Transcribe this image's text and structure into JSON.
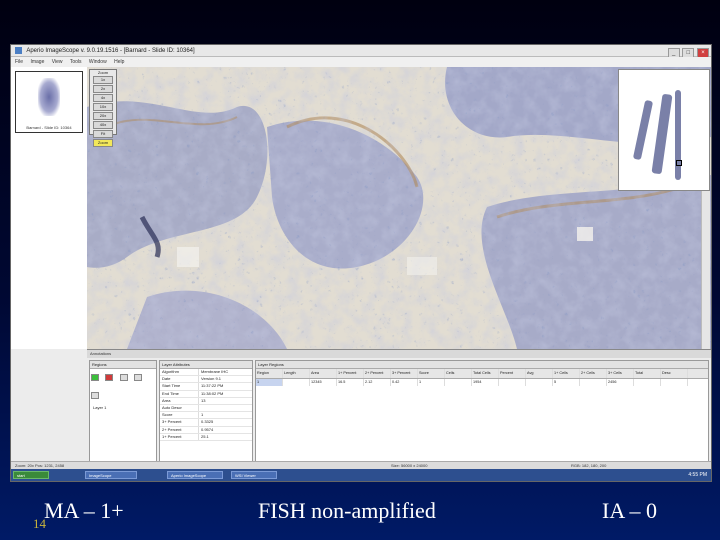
{
  "app": {
    "title": "Aperio ImageScope v. 9.0.19.1516 - [Barnard - Slide ID: 10364]",
    "menu": [
      "File",
      "Image",
      "View",
      "Tools",
      "Window",
      "Help"
    ],
    "window_buttons": [
      "_",
      "□",
      "×"
    ]
  },
  "thumbnail": {
    "caption": "Barnard - Slide ID: 10364"
  },
  "zoom_panel": {
    "title": "Zoom",
    "levels": [
      "1x",
      "2x",
      "4x",
      "10x",
      "20x",
      "40x",
      "Fit",
      "Zoom"
    ],
    "active_index": 7
  },
  "annotations": {
    "panel_title": "Annotations",
    "regions_title": "Regions",
    "region_item": "Layer 1",
    "tools": [
      "green",
      "red",
      "plain",
      "plain",
      "plain"
    ],
    "attributes_title": "Layer Attributes",
    "attributes": [
      {
        "k": "Algorithm",
        "v": "Membrane IHC"
      },
      {
        "k": "Date",
        "v": "Version 9.1"
      },
      {
        "k": "Start Time",
        "v": "11:37:22 PM"
      },
      {
        "k": "End Time",
        "v": "11:38:02 PM"
      },
      {
        "k": "Area",
        "v": "13"
      },
      {
        "k": "Auto Descr",
        "v": ""
      },
      {
        "k": "Score",
        "v": "1"
      },
      {
        "k": "3+ Percent",
        "v": "0.3325"
      },
      {
        "k": "2+ Percent",
        "v": "0.9574"
      },
      {
        "k": "1+ Percent",
        "v": "25.1"
      }
    ],
    "layer_regions_title": "Layer Regions",
    "grid_headers": [
      "Region",
      "Length",
      "Area",
      "1+ Percent",
      "2+ Percent",
      "3+ Percent",
      "Score",
      "Cells",
      "Total Cells",
      "Percent",
      "Avg",
      "1+ Cells",
      "2+ Cells",
      "3+ Cells",
      "Total",
      "Desc"
    ],
    "grid_row": [
      "1",
      "",
      "12345",
      "16.5",
      "2.12",
      "0.42",
      "1",
      "",
      "1954",
      "",
      "",
      "5",
      "",
      "2456",
      "",
      ""
    ]
  },
  "statusbar": {
    "left": "Zoom: 20x    Pos: 1231, 2458",
    "mid": "Size: 56000 x 24000",
    "right": "RGB: 182, 180, 200"
  },
  "taskbar": {
    "start": "start",
    "apps": [
      "ImageScope",
      "Aperio ImageScope",
      "WSI Viewer"
    ],
    "time": "4:55 PM"
  },
  "captions": {
    "left": "MA – 1+",
    "middle": "FISH non-amplified",
    "right": "IA – 0",
    "slide_number": "14"
  },
  "colors": {
    "slide_bg_top": "#000010",
    "slide_bg_bottom": "#001a66",
    "tissue_stroma": "#e2ddd2",
    "tissue_nuclei": "#3e5590",
    "membrane_brown": "#b08a5a",
    "zoom_active": "#f2e85a",
    "slide_number": "#c8b43c"
  }
}
